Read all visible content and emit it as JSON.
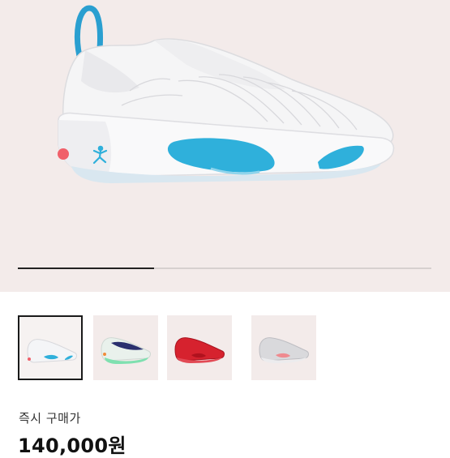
{
  "gallery": {
    "main_image": "white-basketball-shoe-blue-accents",
    "image_progress": 0.33,
    "thumbnails": [
      {
        "name": "thumbnail-white-blue",
        "selected": true,
        "colors": {
          "upper": "#f4f5f7",
          "accent": "#2fb0db",
          "sole": "#e8eef3"
        }
      },
      {
        "name": "thumbnail-white-green-navy",
        "selected": false,
        "colors": {
          "upper": "#e9f1ec",
          "accent": "#2a2f6e",
          "sole": "#7fe0b0"
        }
      },
      {
        "name": "thumbnail-red",
        "selected": false,
        "colors": {
          "upper": "#d6222e",
          "accent": "#b0121e",
          "sole": "#e24a55"
        }
      },
      {
        "name": "thumbnail-grey-pink",
        "selected": false,
        "colors": {
          "upper": "#d9d9dc",
          "accent": "#ef8a8f",
          "sole": "#ececee"
        }
      }
    ]
  },
  "purchase": {
    "label": "즉시 구매가",
    "price": "140,000원"
  },
  "colors": {
    "hero_background": "#f3ebea",
    "accent_blue": "#2fb0db"
  }
}
